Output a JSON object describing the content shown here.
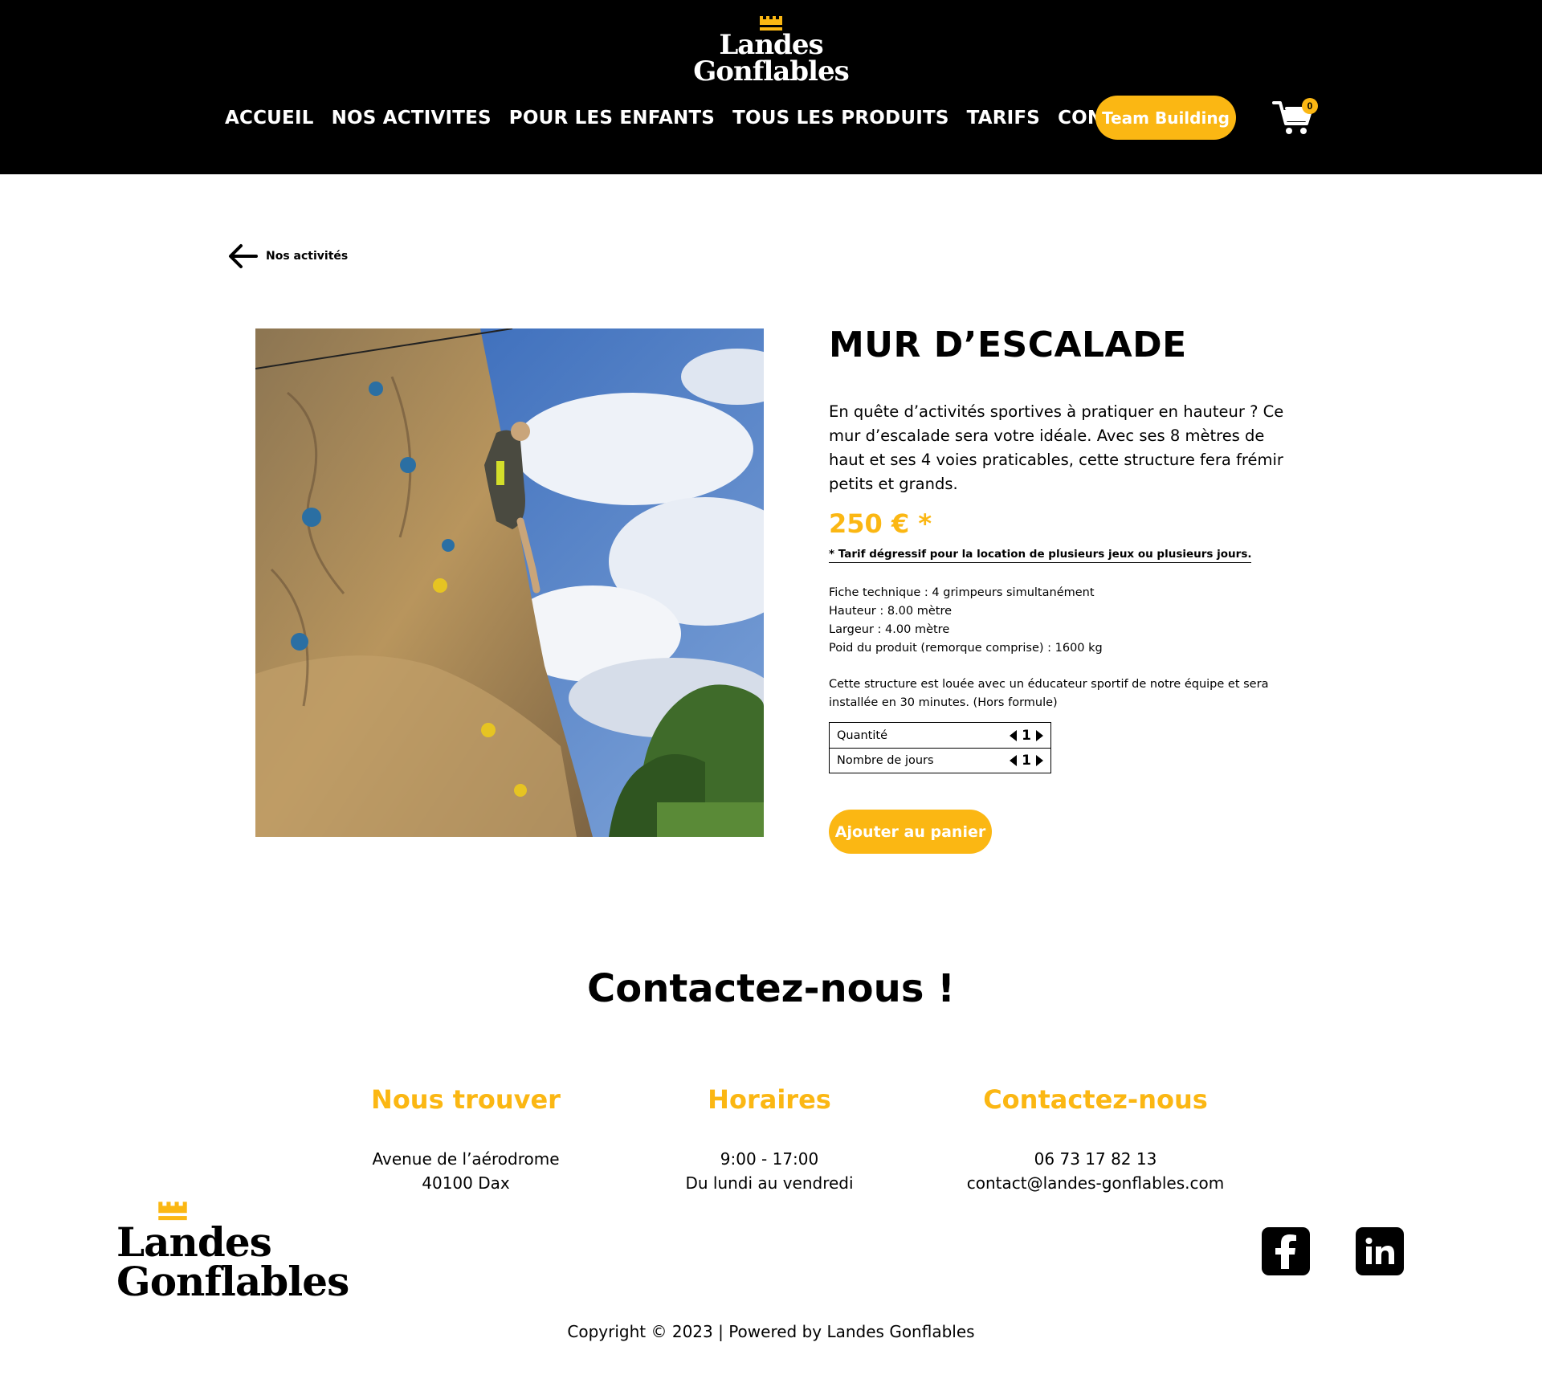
{
  "brand": {
    "line1": "Landes",
    "line2": "Gonflables"
  },
  "nav": {
    "items": [
      "ACCUEIL",
      "NOS ACTIVITES",
      "POUR LES ENFANTS",
      "TOUS LES PRODUITS",
      "TARIFS",
      "CONTACT"
    ],
    "team_building": "Team Building",
    "cart_count": "0"
  },
  "back": {
    "label": "Nos activités"
  },
  "product": {
    "title": "MUR D’ESCALADE",
    "description": "En quête d’activités sportives à pratiquer en hauteur ? Ce mur d’escalade sera votre idéale. Avec ses 8 mètres de haut et ses 4 voies praticables, cette structure fera frémir petits et grands.",
    "price": "250 € *",
    "tarif_note": "* Tarif dégressif pour la location de plusieurs jeux  ou plusieurs jours.",
    "specs": [
      "Fiche technique : 4 grimpeurs simultanément",
      "Hauteur : 8.00 mètre",
      "Largeur : 4.00 mètre",
      "Poid du produit (remorque comprise) : 1600 kg"
    ],
    "note": "Cette structure est louée avec un éducateur sportif de notre équipe et sera installée en 30 minutes. (Hors formule)",
    "options": [
      {
        "label": "Quantité",
        "value": "1"
      },
      {
        "label": "Nombre de jours",
        "value": "1"
      }
    ],
    "add_button": "Ajouter au panier"
  },
  "contact": {
    "title": "Contactez-nous !",
    "columns": [
      {
        "heading": "Nous trouver",
        "lines": [
          "Avenue de l’aérodrome",
          "40100 Dax"
        ]
      },
      {
        "heading": "Horaires",
        "lines": [
          "9:00 - 17:00",
          "Du lundi au vendredi"
        ]
      },
      {
        "heading": "Contactez-nous",
        "lines": [
          "06 73 17 82 13",
          "contact@landes-gonflables.com"
        ]
      }
    ]
  },
  "footer": {
    "social": [
      "facebook-icon",
      "linkedin-icon"
    ],
    "copyright": "Copyright © 2023 | Powered by Landes Gonflables"
  },
  "colors": {
    "accent": "#fbb713",
    "header_bg": "#000000"
  }
}
